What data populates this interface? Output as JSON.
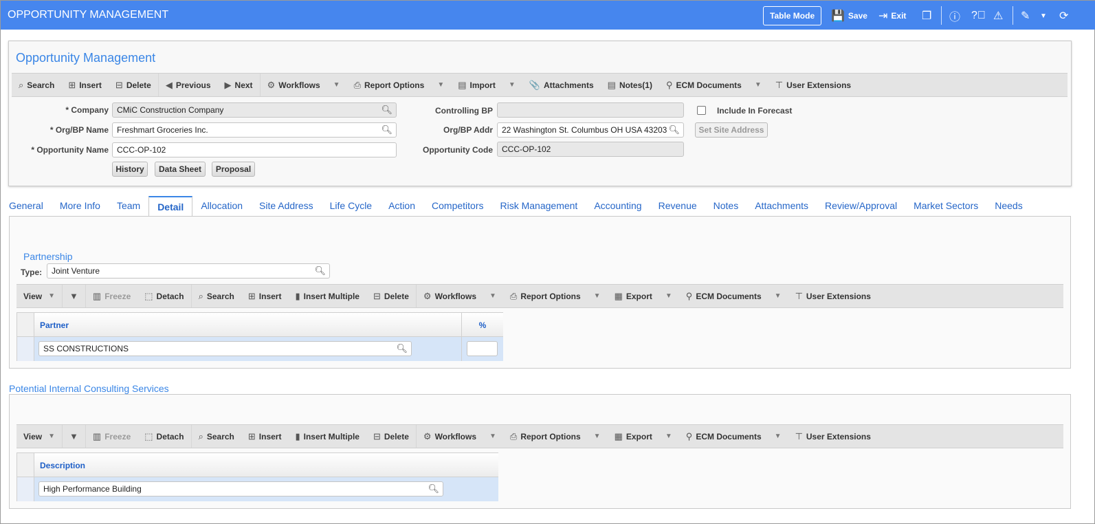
{
  "header": {
    "title": "OPPORTUNITY MANAGEMENT",
    "table_mode": "Table Mode",
    "save": "Save",
    "exit": "Exit"
  },
  "form": {
    "title": "Opportunity Management",
    "toolbar": [
      {
        "icon": "search-icon",
        "g": "⌕",
        "label": "Search"
      },
      {
        "icon": "insert-icon",
        "g": "⊞",
        "label": "Insert"
      },
      {
        "icon": "delete-icon",
        "g": "⊟",
        "label": "Delete"
      },
      {
        "sep": true
      },
      {
        "icon": "arrow-left-icon",
        "g": "◀",
        "label": "Previous"
      },
      {
        "icon": "arrow-right-icon",
        "g": "▶",
        "label": "Next"
      },
      {
        "sep": true
      },
      {
        "icon": "gears-icon",
        "g": "⚙",
        "label": "Workflows",
        "dd": true
      },
      {
        "icon": "printer-icon",
        "g": "⎙",
        "label": "Report Options",
        "dd": true
      },
      {
        "icon": "import-icon",
        "g": "▤",
        "label": "Import",
        "dd": true
      },
      {
        "icon": "paperclip-icon",
        "g": "📎",
        "label": "Attachments"
      },
      {
        "icon": "notes-icon",
        "g": "▤",
        "label": "Notes(1)"
      },
      {
        "icon": "ecm-icon",
        "g": "⚲",
        "label": "ECM Documents",
        "dd": true
      },
      {
        "icon": "hierarchy-icon",
        "g": "⊤",
        "label": "User Extensions"
      }
    ],
    "company_label": "* Company",
    "company": "CMiC Construction Company",
    "orgbp_label": "* Org/BP Name",
    "orgbp": "Freshmart Groceries Inc.",
    "oppname_label": "* Opportunity Name",
    "oppname": "CCC-OP-102",
    "history": "History",
    "datasheet": "Data Sheet",
    "proposal": "Proposal",
    "ctrlbp_label": "Controlling BP",
    "ctrlbp": "",
    "orgaddr_label": "Org/BP Addr",
    "orgaddr": "22 Washington St.  Columbus OH USA 43203",
    "oppcode_label": "Opportunity Code",
    "oppcode": "CCC-OP-102",
    "forecast_label": "Include In Forecast",
    "forecast_checked": false,
    "set_site": "Set Site Address"
  },
  "tabs": [
    "General",
    "More Info",
    "Team",
    "Detail",
    "Allocation",
    "Site Address",
    "Life Cycle",
    "Action",
    "Competitors",
    "Risk Management",
    "Accounting",
    "Revenue",
    "Notes",
    "Attachments",
    "Review/Approval",
    "Market Sectors",
    "Needs"
  ],
  "active_tab": "Detail",
  "grid_toolbar": [
    {
      "label": "View",
      "dd": true,
      "noicon": true
    },
    {
      "sep": true
    },
    {
      "icon": "filter-icon",
      "g": "▼",
      "label": ""
    },
    {
      "sep": true
    },
    {
      "icon": "freeze-icon",
      "g": "▥",
      "label": "Freeze",
      "dis": true
    },
    {
      "icon": "detach-icon",
      "g": "⬚",
      "label": "Detach"
    },
    {
      "sep": true
    },
    {
      "icon": "search-icon",
      "g": "⌕",
      "label": "Search"
    },
    {
      "icon": "insert-icon",
      "g": "⊞",
      "label": "Insert"
    },
    {
      "icon": "insert-multiple-icon",
      "g": "▮",
      "label": "Insert Multiple"
    },
    {
      "icon": "delete-icon",
      "g": "⊟",
      "label": "Delete"
    },
    {
      "sep": true
    },
    {
      "icon": "gears-icon",
      "g": "⚙",
      "label": "Workflows",
      "dd": true
    },
    {
      "icon": "printer-icon",
      "g": "⎙",
      "label": "Report Options",
      "dd": true
    },
    {
      "icon": "export-icon",
      "g": "▦",
      "label": "Export",
      "dd": true
    },
    {
      "icon": "ecm-icon",
      "g": "⚲",
      "label": "ECM Documents",
      "dd": true
    },
    {
      "icon": "hierarchy-icon",
      "g": "⊤",
      "label": "User Extensions"
    }
  ],
  "partnership": {
    "title": "Partnership",
    "type_label": "Type:",
    "type": "Joint Venture",
    "col_partner": "Partner",
    "col_pct": "%",
    "rows": [
      {
        "partner": "SS CONSTRUCTIONS",
        "pct": ""
      }
    ]
  },
  "consulting": {
    "title": "Potential Internal Consulting Services",
    "col_desc": "Description",
    "rows": [
      {
        "desc": "High Performance Building"
      }
    ]
  }
}
